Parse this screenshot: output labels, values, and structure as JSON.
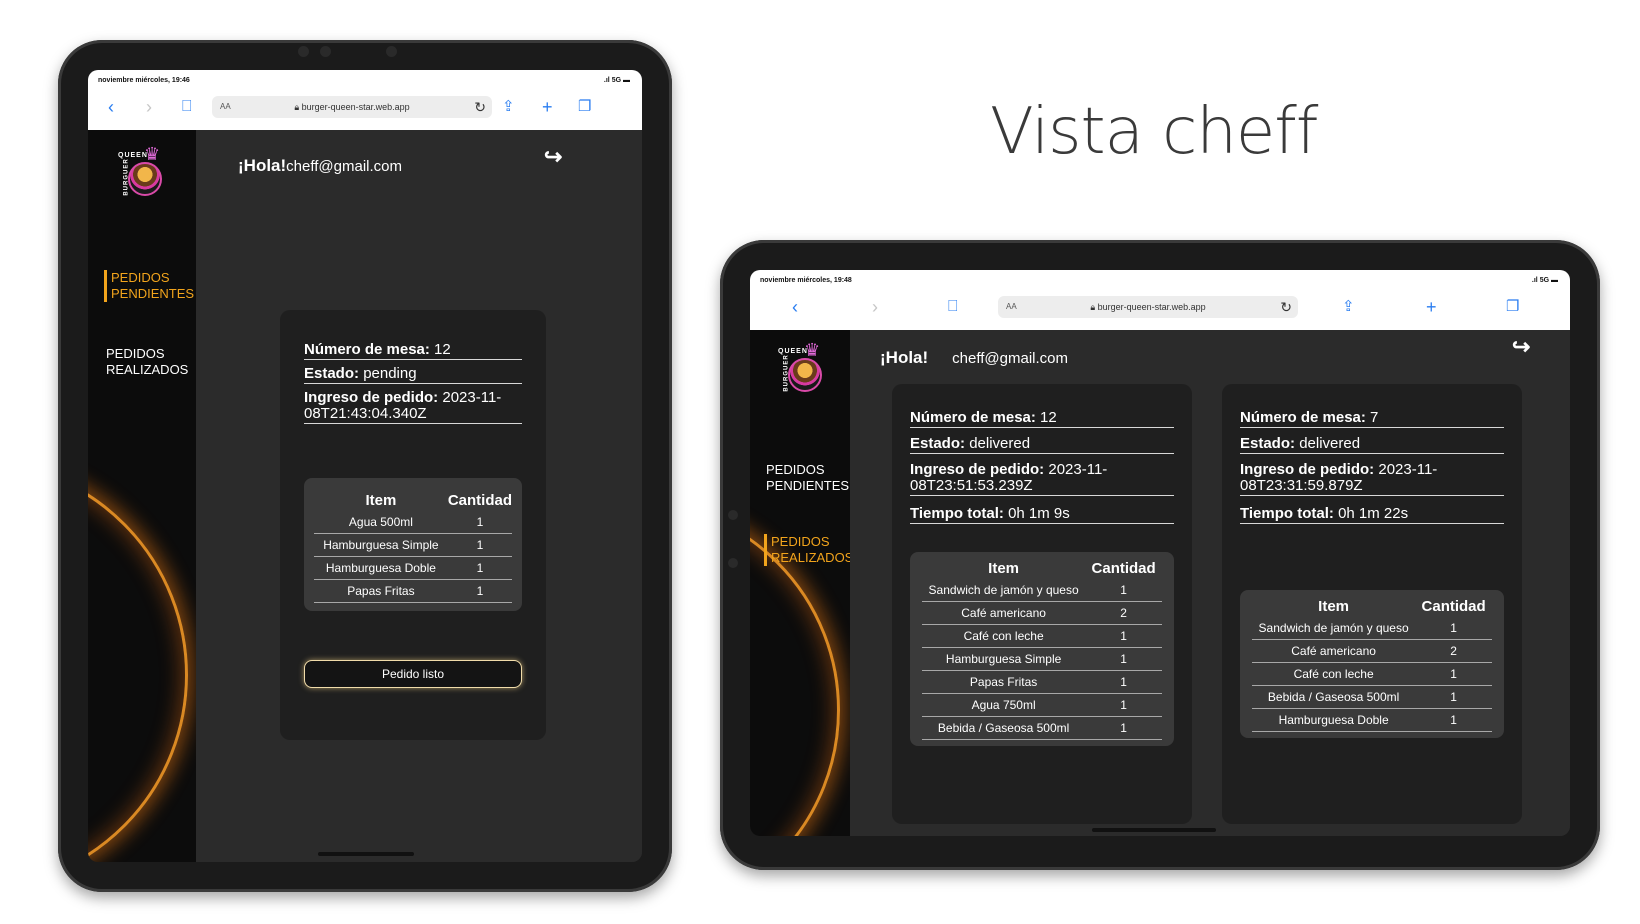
{
  "page_title": "Vista cheff",
  "colors": {
    "accent": "#f2a41c",
    "browser_blue": "#2a7df0",
    "sidebar": "#0c0c0c",
    "card": "#1f1f1f"
  },
  "ipad_portrait": {
    "status_time": "noviembre miércoles, 19:46",
    "status_signal": "5G",
    "browser": {
      "url": "burger-queen-star.web.app",
      "aa_label": "AA",
      "icons": {
        "back": "chevron-left-icon",
        "forward": "chevron-right-icon",
        "bookmarks": "book-icon",
        "reload": "reload-icon",
        "share": "share-icon",
        "new_tab": "plus-icon",
        "tabs": "tabs-icon"
      }
    },
    "logo_text_top": "QUEEN",
    "logo_text_side": "BURGUER",
    "greeting_prefix": "¡Hola!",
    "user_email": "cheff@gmail.com",
    "nav": [
      {
        "label": "PEDIDOS PENDIENTES",
        "active": true
      },
      {
        "label": "PEDIDOS REALIZADOS",
        "active": false
      }
    ],
    "order": {
      "table_label": "Número de mesa:",
      "table_value": "12",
      "status_label": "Estado:",
      "status_value": "pending",
      "entry_label": "Ingreso de pedido:",
      "entry_value": "2023-11-08T21:43:04.340Z",
      "headers": [
        "Item",
        "Cantidad"
      ],
      "items": [
        [
          "Agua 500ml",
          "1"
        ],
        [
          "Hamburguesa Simple",
          "1"
        ],
        [
          "Hamburguesa Doble",
          "1"
        ],
        [
          "Papas Fritas",
          "1"
        ]
      ],
      "ready_button": "Pedido listo"
    }
  },
  "ipad_landscape": {
    "status_time": "noviembre miércoles, 19:48",
    "status_signal": "5G",
    "browser": {
      "url": "burger-queen-star.web.app",
      "aa_label": "AA"
    },
    "logo_text_top": "QUEEN",
    "logo_text_side": "BURGUER",
    "greeting_prefix": "¡Hola!",
    "user_email": "cheff@gmail.com",
    "nav": [
      {
        "label": "PEDIDOS PENDIENTES",
        "active": false
      },
      {
        "label": "PEDIDOS REALIZADOS",
        "active": true
      }
    ],
    "orders": [
      {
        "table_label": "Número de mesa:",
        "table_value": "12",
        "status_label": "Estado:",
        "status_value": "delivered",
        "entry_label": "Ingreso de pedido:",
        "entry_value": "2023-11-08T23:51:53.239Z",
        "time_label": "Tiempo total:",
        "time_value": "0h 1m 9s",
        "headers": [
          "Item",
          "Cantidad"
        ],
        "items": [
          [
            "Sandwich de jamón y queso",
            "1"
          ],
          [
            "Café americano",
            "2"
          ],
          [
            "Café con leche",
            "1"
          ],
          [
            "Hamburguesa Simple",
            "1"
          ],
          [
            "Papas Fritas",
            "1"
          ],
          [
            "Agua 750ml",
            "1"
          ],
          [
            "Bebida / Gaseosa 500ml",
            "1"
          ]
        ]
      },
      {
        "table_label": "Número de mesa:",
        "table_value": "7",
        "status_label": "Estado:",
        "status_value": "delivered",
        "entry_label": "Ingreso de pedido:",
        "entry_value": "2023-11-08T23:31:59.879Z",
        "time_label": "Tiempo total:",
        "time_value": "0h 1m 22s",
        "headers": [
          "Item",
          "Cantidad"
        ],
        "items": [
          [
            "Sandwich de jamón y queso",
            "1"
          ],
          [
            "Café americano",
            "2"
          ],
          [
            "Café con leche",
            "1"
          ],
          [
            "Bebida / Gaseosa 500ml",
            "1"
          ],
          [
            "Hamburguesa Doble",
            "1"
          ]
        ]
      }
    ]
  }
}
